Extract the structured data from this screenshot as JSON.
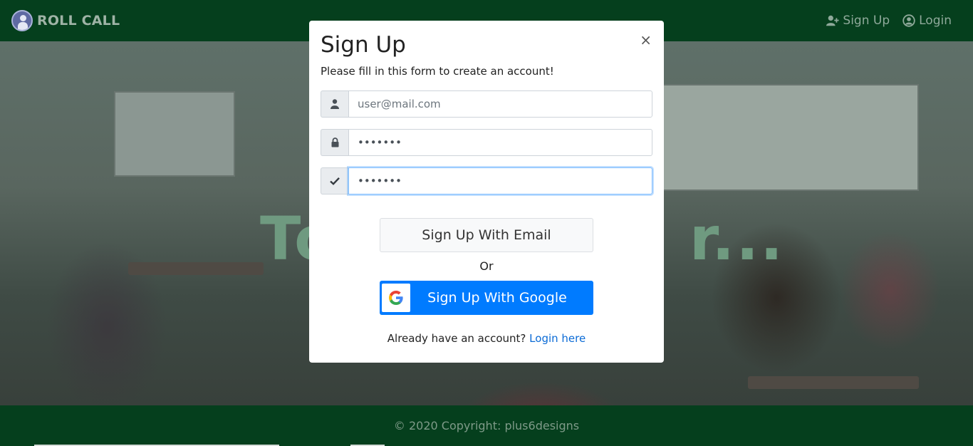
{
  "navbar": {
    "brand": "ROLL CALL",
    "links": [
      {
        "label": "Sign Up",
        "icon": "user-plus-icon"
      },
      {
        "label": "Login",
        "icon": "user-circle-icon"
      }
    ]
  },
  "hero": {
    "visible_text_left": "To",
    "visible_text_right": "r..."
  },
  "modal": {
    "title": "Sign Up",
    "close": "×",
    "subtitle": "Please fill in this form to create an account!",
    "fields": [
      {
        "icon": "user-icon",
        "value": "",
        "placeholder": "user@mail.com",
        "type": "email"
      },
      {
        "icon": "lock-icon",
        "value": "•••••••",
        "placeholder": "",
        "type": "password"
      },
      {
        "icon": "check-icon",
        "value": "•••••••",
        "placeholder": "",
        "type": "password"
      }
    ],
    "email_button": "Sign Up With Email",
    "or": "Or",
    "google_button": "Sign Up With Google",
    "login_prompt": "Already have an account?",
    "login_link": "Login here"
  },
  "footer": {
    "text": "© 2020 Copyright: plus6designs"
  },
  "colors": {
    "navbar_bg": "#053f1d",
    "google_blue": "#007bff",
    "link_blue": "#0b6bd6"
  }
}
